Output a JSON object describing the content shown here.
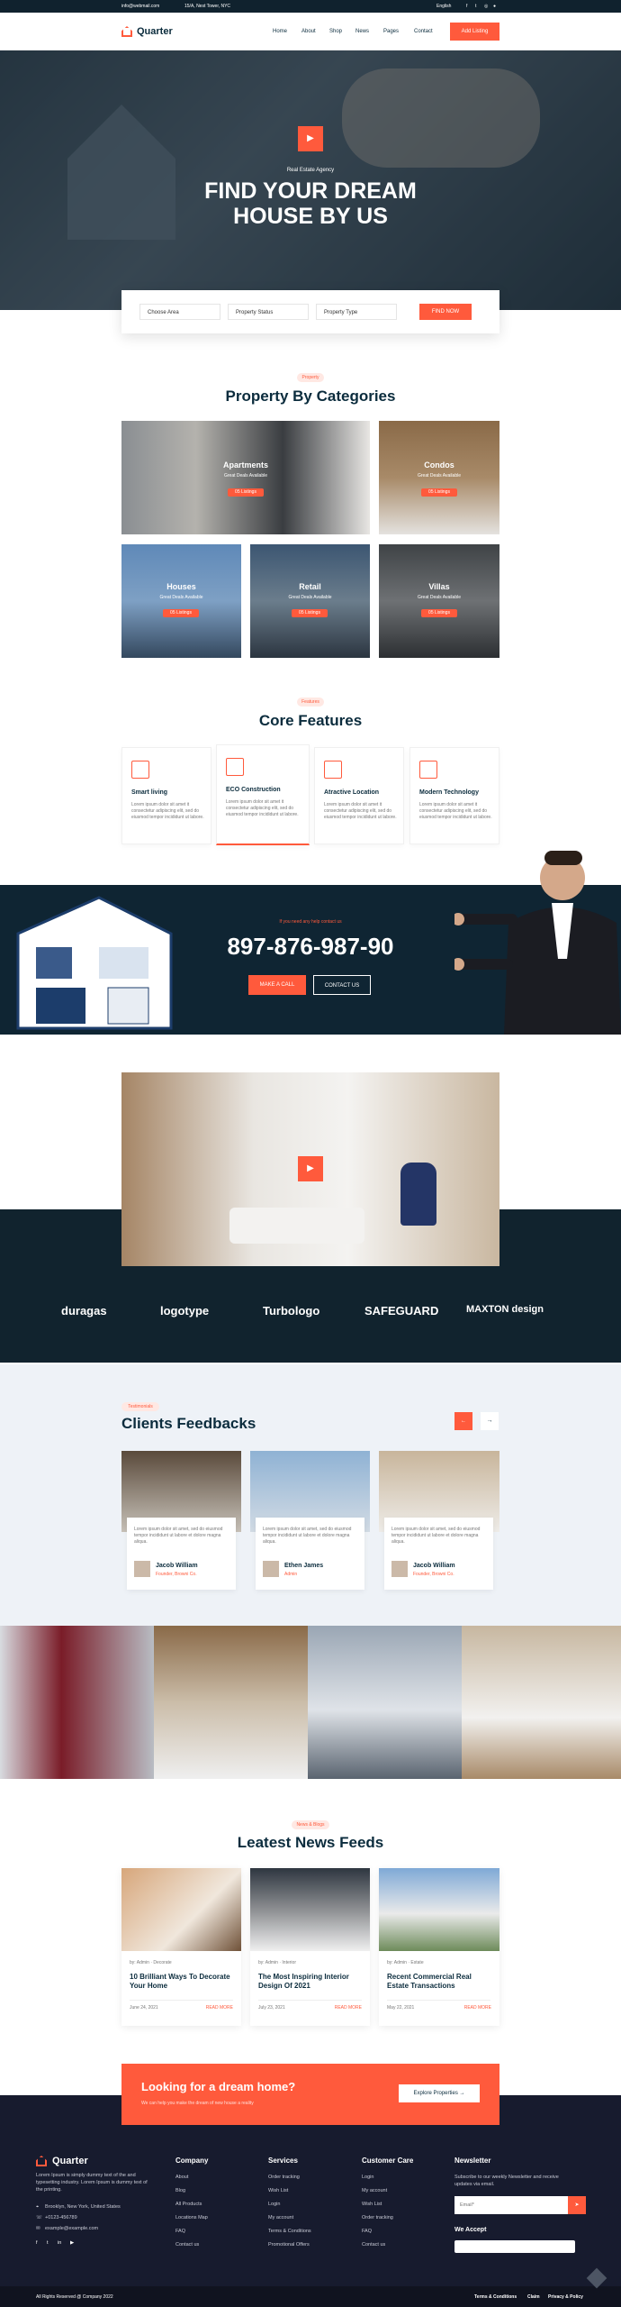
{
  "topbar": {
    "email": "info@webmail.com",
    "address": "15/A, Nest Tower, NYC",
    "lang": "English"
  },
  "nav": {
    "logo": "Quarter",
    "links": [
      "Home",
      "About",
      "Shop",
      "News",
      "Pages",
      "Contact"
    ],
    "cta": "Add Listing"
  },
  "hero": {
    "eyebrow": "Real Estate Agency",
    "title1": "FIND YOUR DREAM",
    "title2": "HOUSE BY US",
    "play": "▶"
  },
  "search": {
    "area": "Choose Area",
    "status": "Property Status",
    "type": "Property Type",
    "button": "FIND NOW"
  },
  "categories": {
    "tag": "Property",
    "title": "Property By Categories",
    "items": [
      {
        "name": "Apartments",
        "sub": "Great Deals Available",
        "count": "05 Listings"
      },
      {
        "name": "Condos",
        "sub": "Great Deals Available",
        "count": "05 Listings"
      },
      {
        "name": "Houses",
        "sub": "Great Deals Available",
        "count": "05 Listings"
      },
      {
        "name": "Retail",
        "sub": "Great Deals Available",
        "count": "05 Listings"
      },
      {
        "name": "Villas",
        "sub": "Great Deals Available",
        "count": "05 Listings"
      }
    ]
  },
  "features": {
    "tag": "Features",
    "title": "Core Features",
    "items": [
      {
        "name": "Smart living",
        "desc": "Lorem ipsum dolor sit amet it consectetur adipiscing elit, sed do eiusmod tempor incididunt ut labore."
      },
      {
        "name": "ECO Construction",
        "desc": "Lorem ipsum dolor sit amet it consectetur adipiscing elit, sed do eiusmod tempor incididunt ut labore."
      },
      {
        "name": "Atractive Location",
        "desc": "Lorem ipsum dolor sit amet it consectetur adipiscing elit, sed do eiusmod tempor incididunt ut labore."
      },
      {
        "name": "Modern Technology",
        "desc": "Lorem ipsum dolor sit amet it consectetur adipiscing elit, sed do eiusmod tempor incididunt ut labore."
      }
    ]
  },
  "cta": {
    "eyebrow": "If you need any help contact us",
    "phone": "897-876-987-90",
    "call": "MAKE A CALL",
    "contact": "CONTACT US"
  },
  "brands": [
    "duragas",
    "logotype",
    "Turbologo",
    "SAFEGUARD",
    "MAXTON design"
  ],
  "testimonials": {
    "tag": "Testimonials",
    "title": "Clients Feedbacks",
    "items": [
      {
        "quote": "Lorem ipsum dolor sit amet, sed do eiusmod tempor incididunt ut labore et dolore magna aliqua.",
        "name": "Jacob William",
        "role": "Founder, Browni Co."
      },
      {
        "quote": "Lorem ipsum dolor sit amet, sed do eiusmod tempor incididunt ut labore et dolore magna aliqua.",
        "name": "Ethen James",
        "role": "Admin"
      },
      {
        "quote": "Lorem ipsum dolor sit amet, sed do eiusmod tempor incididunt ut labore et dolore magna aliqua.",
        "name": "Jacob William",
        "role": "Founder, Browni Co."
      }
    ]
  },
  "news": {
    "tag": "News & Blogs",
    "title": "Leatest News Feeds",
    "items": [
      {
        "author": "by: Admin",
        "cat": "Decorate",
        "title": "10 Brilliant Ways To Decorate Your Home",
        "date": "June 24, 2021",
        "more": "READ MORE"
      },
      {
        "author": "by: Admin",
        "cat": "Interior",
        "title": "The Most Inspiring Interior Design Of 2021",
        "date": "July 23, 2021",
        "more": "READ MORE"
      },
      {
        "author": "by: Admin",
        "cat": "Estate",
        "title": "Recent Commercial Real Estate Transactions",
        "date": "May 22, 2021",
        "more": "READ MORE"
      }
    ]
  },
  "banner": {
    "title": "Looking for a dream home?",
    "sub": "We can help you make the dream of new house a reality",
    "button": "Explore Properties →"
  },
  "footer": {
    "logo": "Quarter",
    "about": "Lorem Ipsum is simply dummy text of the and typesetting industry. Lorem Ipsum is dummy text of the printing.",
    "address": "Brooklyn, New York, United States",
    "phone": "+0123-456789",
    "email": "example@example.com",
    "company": {
      "title": "Company",
      "links": [
        "About",
        "Blog",
        "All Products",
        "Locations Map",
        "FAQ",
        "Contact us"
      ]
    },
    "services": {
      "title": "Services",
      "links": [
        "Order tracking",
        "Wish List",
        "Login",
        "My account",
        "Terms & Conditions",
        "Promotional Offers"
      ]
    },
    "care": {
      "title": "Customer Care",
      "links": [
        "Login",
        "My account",
        "Wish List",
        "Order tracking",
        "FAQ",
        "Contact us"
      ]
    },
    "newsletter": {
      "title": "Newsletter",
      "text": "Subscribe to our weekly Newsletter and receive updates via email.",
      "placeholder": "Email*",
      "accept": "We Accept"
    },
    "copyright": "All Rights Reserved @ Company 2022",
    "bottom_links": [
      "Terms & Conditions",
      "Claim",
      "Privacy & Policy"
    ]
  }
}
